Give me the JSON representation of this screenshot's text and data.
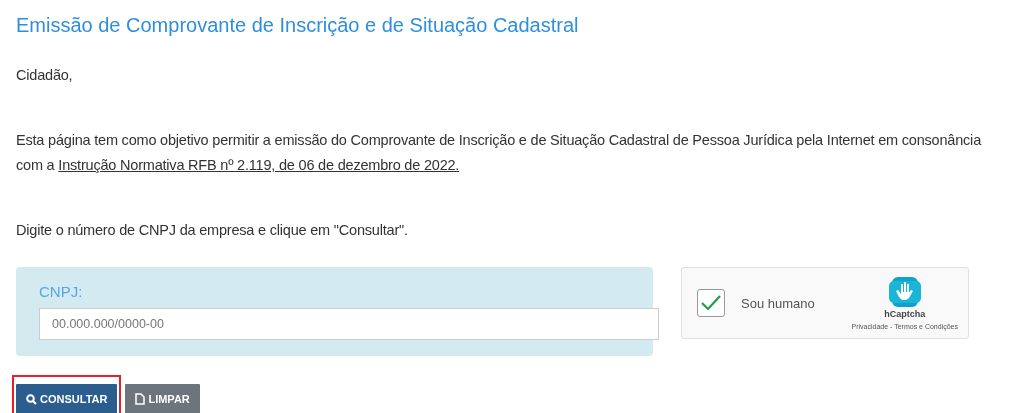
{
  "title": "Emissão de Comprovante de Inscrição e de Situação Cadastral",
  "greeting": "Cidadão,",
  "intro": {
    "text": "Esta página tem como objetivo permitir a emissão do Comprovante de Inscrição e de Situação Cadastral de Pessoa Jurídica pela Internet em consonância com a ",
    "link": "Instrução Normativa RFB nº 2.119, de 06 de dezembro de 2022."
  },
  "instruction": "Digite o número de CNPJ da empresa e clique em \"Consultar\".",
  "form": {
    "label": "CNPJ:",
    "placeholder": "00.000.000/0000-00"
  },
  "captcha": {
    "checked": true,
    "label": "Sou humano",
    "brand": "hCaptcha",
    "links": "Privacidade - Termos e Condições"
  },
  "buttons": [
    {
      "kind": "primary",
      "label": "CONSULTAR",
      "highlighted": true
    },
    {
      "kind": "secondary",
      "label": "LIMPAR",
      "highlighted": false
    }
  ]
}
